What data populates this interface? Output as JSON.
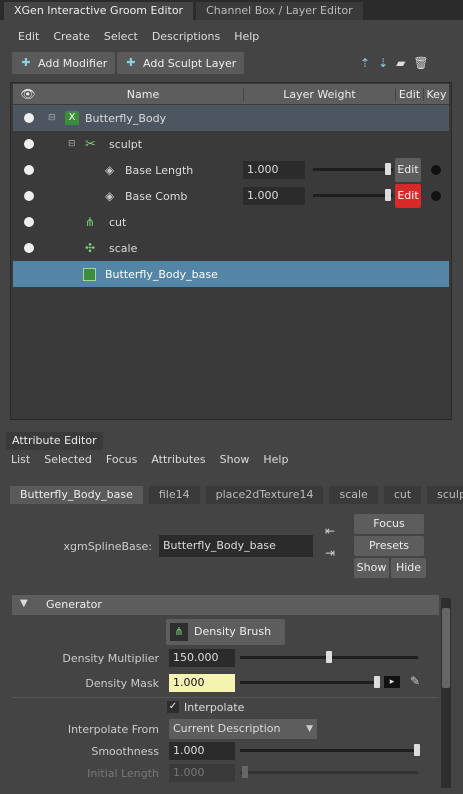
{
  "groom": {
    "tabs": [
      "XGen Interactive Groom Editor",
      "Channel Box / Layer Editor"
    ],
    "menu": [
      "Edit",
      "Create",
      "Select",
      "Descriptions",
      "Help"
    ],
    "add_modifier": "Add Modifier",
    "add_sculpt_layer": "Add Sculpt Layer",
    "columns": {
      "name": "Name",
      "layer_weight": "Layer Weight",
      "edit": "Edit",
      "key": "Key"
    },
    "tree": {
      "root": "Butterfly_Body",
      "sculpt": "sculpt",
      "base_length": "Base Length",
      "base_length_value": "1.000",
      "base_comb": "Base Comb",
      "base_comb_value": "1.000",
      "edit": "Edit",
      "cut": "cut",
      "scale": "scale",
      "base": "Butterfly_Body_base"
    }
  },
  "attr": {
    "title": "Attribute Editor",
    "menu": [
      "List",
      "Selected",
      "Focus",
      "Attributes",
      "Show",
      "Help"
    ],
    "tabs": [
      "Butterfly_Body_base",
      "file14",
      "place2dTexture14",
      "scale",
      "cut",
      "sculpt"
    ],
    "spline_label": "xgmSplineBase:",
    "spline_value": "Butterfly_Body_base",
    "focus": "Focus",
    "presets": "Presets",
    "show": "Show",
    "hide": "Hide",
    "section": "Generator",
    "density_brush": "Density Brush",
    "density_multiplier_label": "Density Multiplier",
    "density_multiplier": "150.000",
    "density_multiplier_level": 0.5,
    "density_mask_label": "Density Mask",
    "density_mask": "1.000",
    "interpolate": "Interpolate",
    "interpolate_from_label": "Interpolate From",
    "interpolate_from": "Current Description",
    "smoothness_label": "Smoothness",
    "smoothness": "1.000",
    "initial_length_label": "Initial Length",
    "initial_length": "1.000"
  },
  "colors": {
    "selected_row": "#5285a6",
    "edit_red": "#d92828",
    "mask_yellow": "#f4f3b0"
  }
}
